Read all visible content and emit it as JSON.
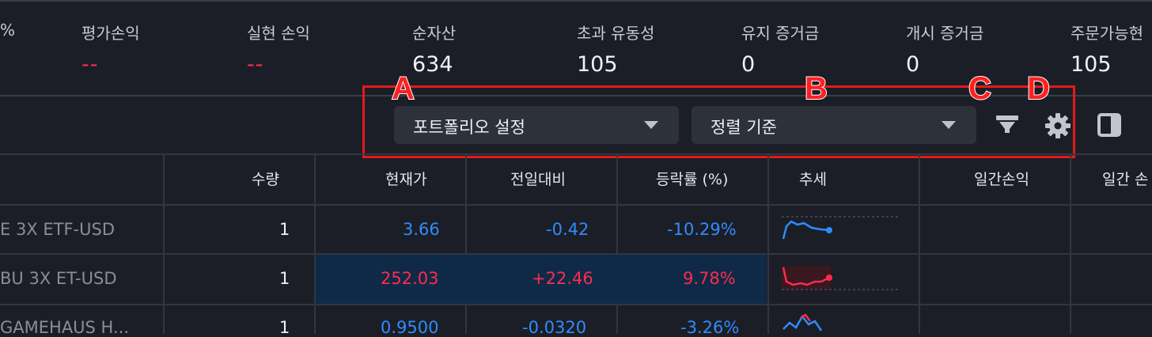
{
  "summary": {
    "partial_left": "%",
    "items": [
      {
        "label": "평가손익",
        "value": "--",
        "color": "#ff2b4d"
      },
      {
        "label": "실현 손익",
        "value": "--",
        "color": "#ff2b4d"
      },
      {
        "label": "순자산",
        "value": "634"
      },
      {
        "label": "초과 유동성",
        "value": "105"
      },
      {
        "label": "유지 증거금",
        "value": "0"
      },
      {
        "label": "개시 증거금",
        "value": "0"
      },
      {
        "label": "주문가능현",
        "value": "105"
      }
    ]
  },
  "toolbar": {
    "portfolio_dropdown": "포트폴리오 설정",
    "sort_dropdown": "정렬 기준",
    "filter_icon": "filter-icon",
    "settings_icon": "gear-icon",
    "panel_icon": "panel-toggle-icon"
  },
  "annotations": {
    "a": "A",
    "b": "B",
    "c": "C",
    "d": "D",
    "color": "#e21a1a"
  },
  "table": {
    "headers": {
      "qty": "수량",
      "price": "현재가",
      "change": "전일대비",
      "pct": "등락률 (%)",
      "trend": "추세",
      "daily_pnl": "일간손익",
      "daily_pnl2": "일간 손"
    },
    "rows": [
      {
        "name": "E 3X ETF-USD",
        "qty": "1",
        "price": "3.66",
        "change": "-0.42",
        "pct": "-10.29%",
        "dir": "down"
      },
      {
        "name": "BU 3X ET-USD",
        "qty": "1",
        "price": "252.03",
        "change": "+22.46",
        "pct": "9.78%",
        "dir": "up"
      },
      {
        "name": "GAMEHAUS H...",
        "qty": "1",
        "price": "0.9500",
        "change": "-0.0320",
        "pct": "-3.26%",
        "dir": "down"
      }
    ]
  },
  "colors": {
    "up": "#ff2b4d",
    "down": "#2f8cff",
    "background": "#1b1e26",
    "dropdown_bg": "#2d313a"
  }
}
